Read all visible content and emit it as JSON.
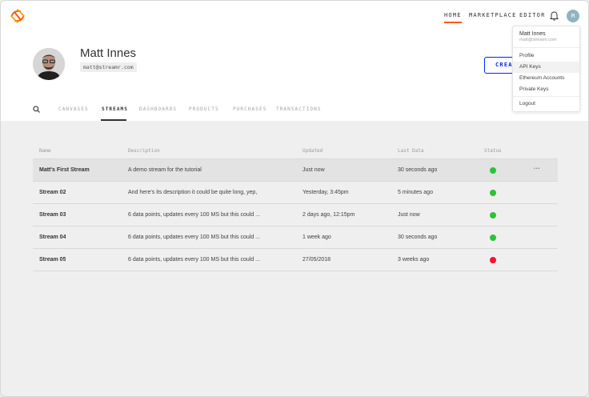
{
  "nav": {
    "links": [
      {
        "label": "HOME",
        "active": true
      },
      {
        "label": "MARKETPLACE",
        "active": false
      },
      {
        "label": "EDITOR",
        "active": false
      }
    ],
    "avatar_initial": "M",
    "bell_icon": "bell-icon",
    "accent_color": "#ff5c00"
  },
  "profile": {
    "name": "Matt Innes",
    "email": "matt@streamr.com"
  },
  "create_button": {
    "label": "CREATE"
  },
  "tabs": [
    {
      "label": "CANVASES",
      "active": false
    },
    {
      "label": "STREAMS",
      "active": true
    },
    {
      "label": "DASHBOARDS",
      "active": false
    },
    {
      "label": "PRODUCTS",
      "active": false
    },
    {
      "label": "PURCHASES",
      "active": false
    },
    {
      "label": "TRANSACTIONS",
      "active": false
    }
  ],
  "table": {
    "headers": {
      "name": "Name",
      "description": "Description",
      "updated": "Updated",
      "last_data": "Last Data",
      "status": "Status"
    },
    "rows": [
      {
        "name": "Matt's First Stream",
        "description": "A demo stream for the tutorial",
        "updated": "Just now",
        "last_data": "30 seconds ago",
        "status": "ok"
      },
      {
        "name": "Stream 02",
        "description": "And here's its description it could be quite long, yep,",
        "updated": "Yesterday, 3:45pm",
        "last_data": "5 minutes ago",
        "status": "ok"
      },
      {
        "name": "Stream 03",
        "description": "6 data points, updates every 100 MS but this could ...",
        "updated": "2 days ago, 12:15pm",
        "last_data": "Just now",
        "status": "ok"
      },
      {
        "name": "Stream 04",
        "description": "6 data points, updates every 100 MS but this could ...",
        "updated": "1 week ago",
        "last_data": "30 seconds ago",
        "status": "ok"
      },
      {
        "name": "Stream 05",
        "description": "6 data points, updates every 100 MS but this could ...",
        "updated": "27/05/2018",
        "last_data": "3 weeks ago",
        "status": "error"
      }
    ],
    "status_colors": {
      "ok": "#2ac437",
      "error": "#ff0f2d"
    }
  },
  "dropdown": {
    "name": "Matt Innes",
    "email": "matt@streamr.com",
    "items": [
      "Profile",
      "API Keys",
      "Ethereum Accounts",
      "Private Keys"
    ],
    "logout": "Logout"
  }
}
